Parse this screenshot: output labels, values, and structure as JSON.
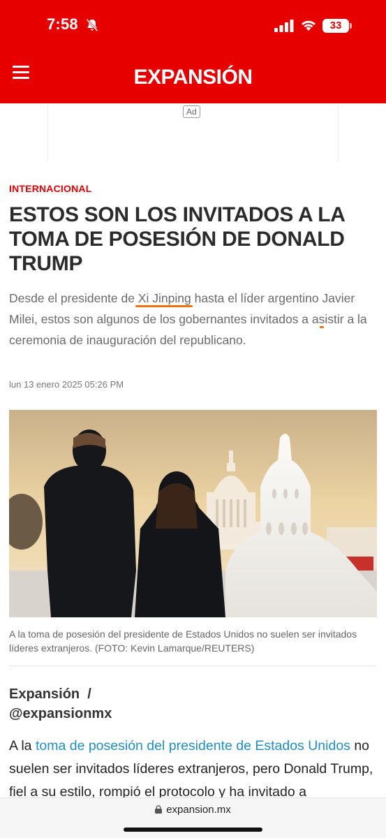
{
  "status_bar": {
    "time": "7:58",
    "battery": "33",
    "icons": [
      "bell-slash-icon",
      "cellular-signal-icon",
      "wifi-icon",
      "battery-icon"
    ]
  },
  "header": {
    "logo": "EXPANSIÓN",
    "menu_icon": "hamburger-menu-icon",
    "background_color": "#e60000"
  },
  "ad": {
    "label": "Ad"
  },
  "article": {
    "section": "INTERNACIONAL",
    "headline": "ESTOS SON LOS INVITADOS A LA TOMA DE POSESIÓN DE DONALD TRUMP",
    "summary": {
      "part1": "Desde el presidente de ",
      "highlight1": "Xi Jinping",
      "part2": " hasta el líder argentino ",
      "highlight2": "Javier Milei,",
      "part3": " estos son algunos de los gobernantes invitados a asistir a la ceremonia de inauguración del republicano."
    },
    "date": "lun 13 enero 2025 05:26 PM",
    "caption": "A la toma de posesión del presidente de Estados Unidos no suelen ser invitados líderes extranjeros. (FOTO: Kevin Lamarque/REUTERS)",
    "byline": {
      "author": "Expansión",
      "separator": "/",
      "handle": "@expansionmx"
    },
    "body": {
      "prefix": "A la ",
      "link": "toma de posesión del presidente de Estados Unidos",
      "text": " no suelen ser invitados líderes extranjeros, pero Donald Trump, fiel a su estilo, rompió el protocolo y ha invitado a"
    },
    "link_color": "#1e8fc6",
    "highlight_color": "#f07010"
  },
  "browser": {
    "url": "expansion.mx",
    "lock_icon": "lock-icon"
  }
}
